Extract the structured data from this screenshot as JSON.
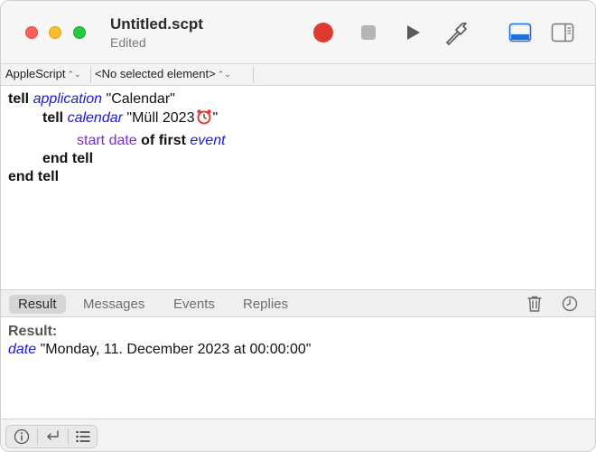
{
  "window": {
    "title": "Untitled.scpt",
    "subtitle": "Edited"
  },
  "toolbar": {
    "record_icon": "record-icon",
    "stop_icon": "stop-icon",
    "run_icon": "run-icon",
    "compile_icon": "hammer-icon",
    "view_icons": [
      "bottom-panel-icon",
      "sidebar-panel-icon"
    ],
    "colors": {
      "record": "#e0392f",
      "accent": "#1a6ee8"
    }
  },
  "navigator": {
    "language": "AppleScript",
    "element": "<No selected element>"
  },
  "script": {
    "line1": {
      "kw": "tell",
      "cls": "application",
      "str": "\"Calendar\""
    },
    "line2": {
      "kw": "tell",
      "cls": "calendar",
      "str_open": "\"Müll 2023",
      "str_close": "\""
    },
    "line3": {
      "prop": "start date",
      "kw": "of first",
      "cls": "event"
    },
    "line4": {
      "kw": "end tell"
    },
    "line5": {
      "kw": "end tell"
    }
  },
  "tabs": [
    {
      "label": "Result",
      "active": true
    },
    {
      "label": "Messages",
      "active": false
    },
    {
      "label": "Events",
      "active": false
    },
    {
      "label": "Replies",
      "active": false
    }
  ],
  "result": {
    "label": "Result:",
    "type": "date",
    "value": "\"Monday, 11. December 2023 at 00:00:00\""
  },
  "footer": {
    "icons": [
      "info-icon",
      "return-icon",
      "list-icon"
    ]
  }
}
